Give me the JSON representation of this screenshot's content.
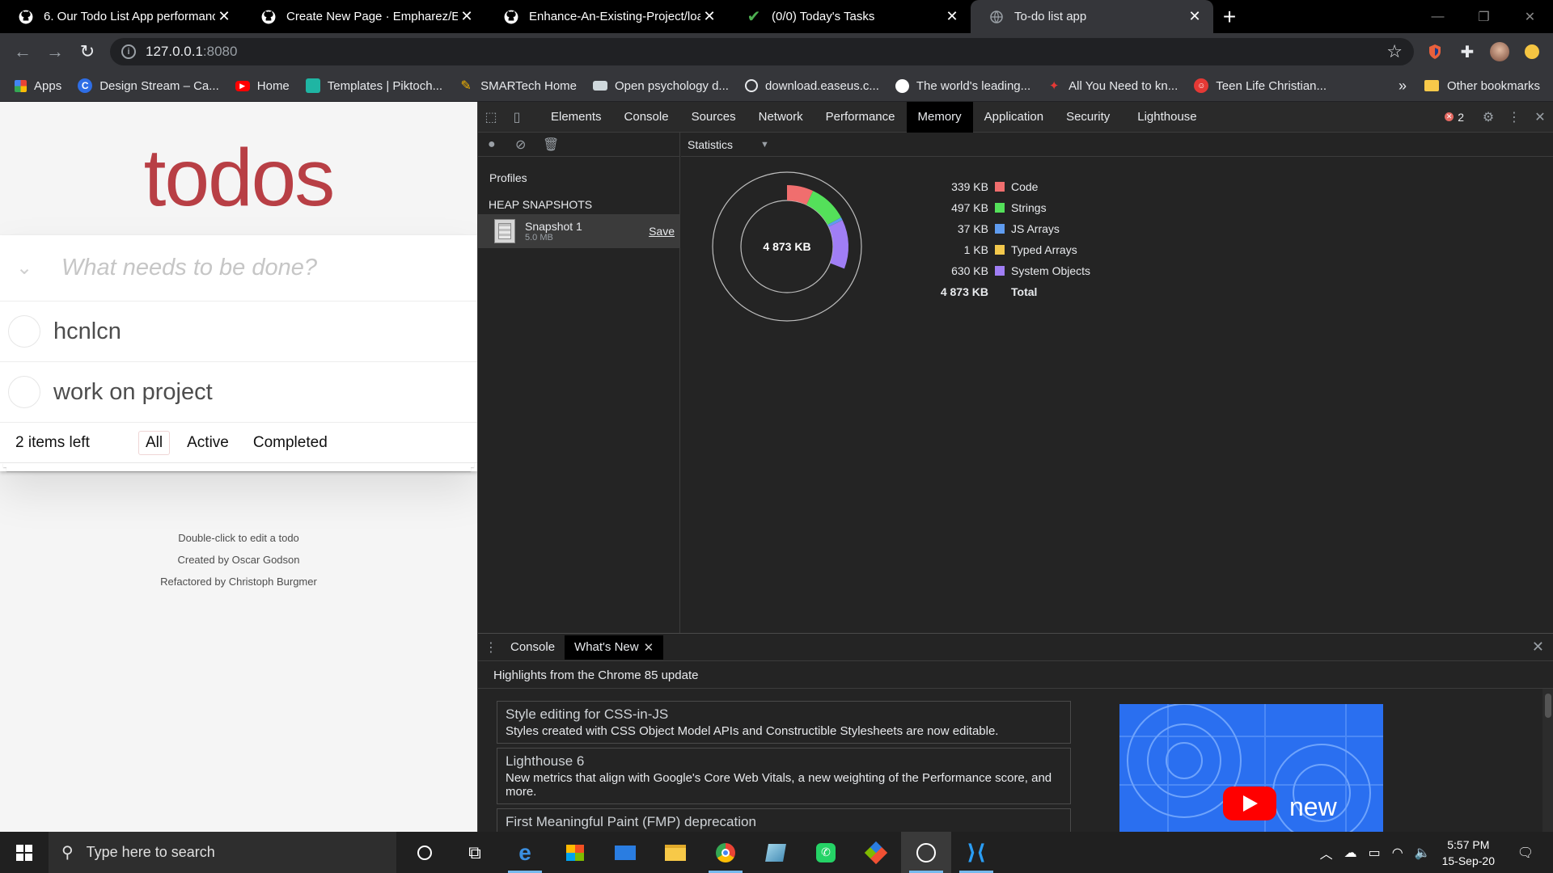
{
  "browser": {
    "tabs": [
      {
        "title": "6. Our Todo List App performanc",
        "icon": "github-icon"
      },
      {
        "title": "Create New Page · Empharez/Enh",
        "icon": "github-icon"
      },
      {
        "title": "Enhance-An-Existing-Project/loa",
        "icon": "github-icon"
      },
      {
        "title": "(0/0) Today's Tasks",
        "icon": "checkmark-icon"
      },
      {
        "title": "To-do list app",
        "icon": "globe-icon"
      }
    ],
    "url_host": "127.0.0.1",
    "url_port": ":8080",
    "bookmarks": [
      {
        "label": "Apps",
        "icon": "apps-grid-icon",
        "color": "#ea4335"
      },
      {
        "label": "Design Stream – Ca...",
        "icon": "canva-icon",
        "color": "#2e6ee6"
      },
      {
        "label": "Home",
        "icon": "youtube-icon",
        "color": "#ff0000"
      },
      {
        "label": "Templates | Piktoch...",
        "icon": "piktochart-icon",
        "color": "#1fb5a3"
      },
      {
        "label": "SMARTech Home",
        "icon": "smartech-icon",
        "color": "#f4b400"
      },
      {
        "label": "Open psychology d...",
        "icon": "flag-icon",
        "color": "#cfd8dc"
      },
      {
        "label": "download.easeus.c...",
        "icon": "globe-icon",
        "color": "#e8eaed"
      },
      {
        "label": "The world's leading...",
        "icon": "github-icon",
        "color": "#ffffff"
      },
      {
        "label": "All You Need to kn...",
        "icon": "bird-icon",
        "color": "#e53935"
      },
      {
        "label": "Teen Life Christian...",
        "icon": "teenlife-icon",
        "color": "#e53935"
      }
    ],
    "bookmarks_more": "»",
    "other_bookmarks": "Other bookmarks"
  },
  "todo": {
    "title": "todos",
    "placeholder": "What needs to be done?",
    "items": [
      {
        "label": "hcnlcn",
        "completed": false
      },
      {
        "label": "work on project",
        "completed": false
      }
    ],
    "count": "2 items left",
    "filters": [
      "All",
      "Active",
      "Completed"
    ],
    "selected_filter": "All",
    "info": [
      "Double-click to edit a todo",
      "Created by Oscar Godson",
      "Refactored by Christoph Burgmer"
    ],
    "title_color": "#b83f45"
  },
  "devtools": {
    "tabs": [
      "Elements",
      "Console",
      "Sources",
      "Network",
      "Performance",
      "Memory",
      "Application",
      "Security",
      "Lighthouse"
    ],
    "active_tab": "Memory",
    "error_count": "2",
    "profiles_label": "Profiles",
    "heap_label": "HEAP SNAPSHOTS",
    "snapshot": {
      "name": "Snapshot 1",
      "size": "5.0 MB",
      "save": "Save"
    },
    "view_select": "Statistics",
    "drawer": {
      "tabs": [
        "Console",
        "What's New"
      ],
      "active_tab": "What's New",
      "highlights": "Highlights from the Chrome 85 update",
      "cards": [
        {
          "title": "Style editing for CSS-in-JS",
          "desc": "Styles created with CSS Object Model APIs and Constructible Stylesheets are now editable."
        },
        {
          "title": "Lighthouse 6",
          "desc": "New metrics that align with Google's Core Web Vitals, a new weighting of the Performance score, and more."
        },
        {
          "title": "First Meaningful Paint (FMP) deprecation",
          "desc": ""
        }
      ],
      "video_label": "new"
    }
  },
  "chart_data": {
    "type": "pie",
    "center_label": "4 873 KB",
    "series": [
      {
        "name": "Code",
        "label": "339 KB",
        "value": 339,
        "color": "#f06e6e"
      },
      {
        "name": "Strings",
        "label": "497 KB",
        "value": 497,
        "color": "#54e05a"
      },
      {
        "name": "JS Arrays",
        "label": "37 KB",
        "value": 37,
        "color": "#5f9cf0"
      },
      {
        "name": "Typed Arrays",
        "label": "1 KB",
        "value": 1,
        "color": "#f3c84c"
      },
      {
        "name": "System Objects",
        "label": "630 KB",
        "value": 630,
        "color": "#a07ef5"
      }
    ],
    "total": {
      "name": "Total",
      "label": "4 873 KB",
      "value": 4873
    }
  },
  "taskbar": {
    "search_placeholder": "Type here to search",
    "time": "5:57 PM",
    "date": "15-Sep-20"
  }
}
